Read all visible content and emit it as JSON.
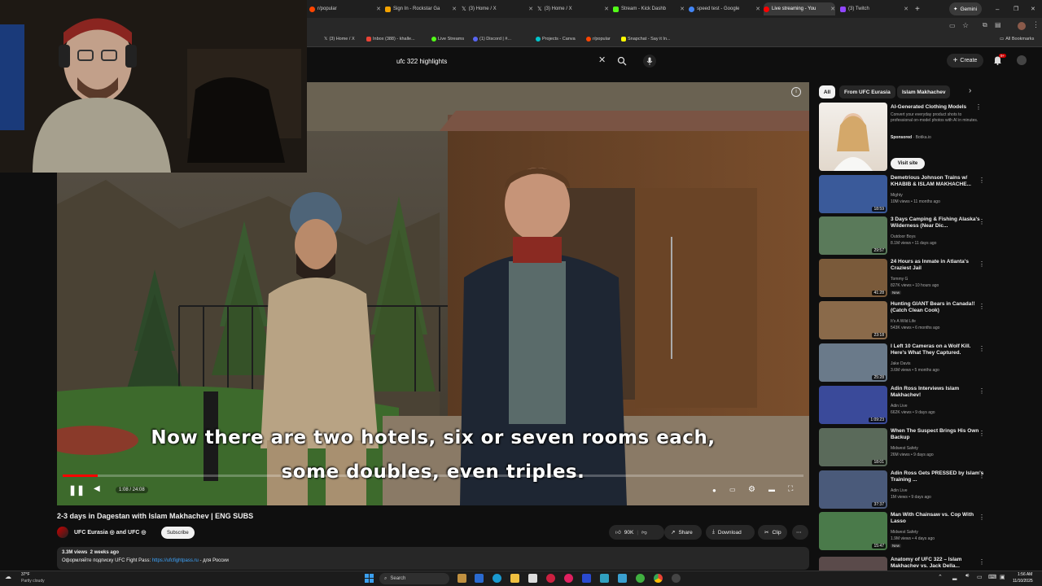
{
  "browser": {
    "tabs": [
      {
        "label": "r/popular",
        "color": "#ff4500"
      },
      {
        "label": "Sign In - Rockstar Ga",
        "color": "#f3a200"
      },
      {
        "label": "(3) Home / X",
        "color": "#ffffff"
      },
      {
        "label": "(3) Home / X",
        "color": "#ffffff"
      },
      {
        "label": "Stream - Kick Dashb",
        "color": "#53fc18"
      },
      {
        "label": "speed test - Google",
        "color": "#4285f4"
      },
      {
        "label": "Live streaming - You",
        "color": "#ff0000"
      },
      {
        "label": "(3) Twitch",
        "color": "#9146ff"
      }
    ],
    "gemini_label": "Gemini",
    "bookmarks": [
      {
        "label": "(3) Home / X",
        "color": "#ffffff"
      },
      {
        "label": "Inbox (388) - khalle...",
        "color": "#ea4335"
      },
      {
        "label": "Live Streams",
        "color": "#53fc18"
      },
      {
        "label": "(1) Discord | #...",
        "color": "#5865f2"
      },
      {
        "label": "Projects - Canva",
        "color": "#00c4cc"
      },
      {
        "label": "r/popular",
        "color": "#ff4500"
      },
      {
        "label": "Snapchat - Say it In...",
        "color": "#fffc00"
      }
    ],
    "all_bookmarks": "All Bookmarks"
  },
  "youtube": {
    "search_query": "ufc 322 highlights",
    "create_label": "Create",
    "notif_count": "9+"
  },
  "player": {
    "caption_line1": "Now there are two hotels, six or seven rooms each,",
    "caption_line2": "some doubles, even triples.",
    "time": "1:08 / 24:08",
    "progress": 0.047
  },
  "video": {
    "title": "2-3 days in Dagestan with Islam Makhachev | ENG SUBS",
    "channel": "UFC Eurasia ◎ and UFC ◎",
    "subscribe": "Subscribe",
    "likes": "90K",
    "share": "Share",
    "download": "Download",
    "clip": "Clip",
    "views_line": "3.3M views  2 weeks ago",
    "desc_prefix": "Оформляйте подписку UFC Fight Pass:",
    "desc_link": "https://ufcfightpass.ru",
    "desc_suffix": "- для России"
  },
  "sidebar": {
    "chips": [
      "All",
      "From UFC Eurasia",
      "Islam Makhachev"
    ],
    "ad": {
      "title": "AI-Generated Clothing Models",
      "desc": "Convert your everyday product shots to professional on-model photos with AI in minutes.",
      "sponsored": "Sponsored",
      "advertiser": "Botika.io",
      "cta": "Visit site"
    },
    "items": [
      {
        "title": "Demetrious Johnson Trains w/ KHABIB & ISLAM MAKHACHE...",
        "channel": "Mighty",
        "meta": "10M views • 11 months ago",
        "duration": "18:59",
        "new": "",
        "bg": "#3a5a9a"
      },
      {
        "title": "3 Days Camping & Fishing Alaska's Wilderness (Near Dic...",
        "channel": "Outdoor Boys",
        "meta": "8.1M views • 11 days ago",
        "duration": "29:57",
        "new": "",
        "bg": "#5a7a5a"
      },
      {
        "title": "24 Hours as Inmate in Atlanta's Craziest Jail",
        "channel": "Tommy G",
        "meta": "827K views • 10 hours ago",
        "duration": "41:28",
        "new": "New",
        "bg": "#7a5a3a"
      },
      {
        "title": "Hunting GIANT Bears in Canada!! (Catch Clean Cook)",
        "channel": "It's A Wild Life",
        "meta": "543K views • 6 months ago",
        "duration": "23:18",
        "new": "",
        "bg": "#8a6a4a"
      },
      {
        "title": "I Left 10 Cameras on a Wolf Kill. Here's What They Captured.",
        "channel": "Jake Davis",
        "meta": "3.6M views • 5 months ago",
        "duration": "25:28",
        "new": "",
        "bg": "#6a7a8a"
      },
      {
        "title": "Adin Ross Interviews Islam Makhachev!",
        "channel": "Adin Live",
        "meta": "662K views • 9 days ago",
        "duration": "1:09:23",
        "new": "",
        "bg": "#3a4a9a"
      },
      {
        "title": "When The Suspect Brings His Own Backup",
        "channel": "Midwest Safety",
        "meta": "26M views • 9 days ago",
        "duration": "18:01",
        "new": "",
        "bg": "#5a6a5a"
      },
      {
        "title": "Adin Ross Gets PRESSED by Islam's Training ...",
        "channel": "Adin Live",
        "meta": "1M views • 9 days ago",
        "duration": "37:37",
        "new": "",
        "bg": "#4a5a7a"
      },
      {
        "title": "Man With Chainsaw vs. Cop With Lasso",
        "channel": "Midwest Safety",
        "meta": "1.9M views • 4 days ago",
        "duration": "15:47",
        "new": "New",
        "bg": "#4a7a4a"
      },
      {
        "title": "Anatomy of UFC 322 – Islam Makhachev vs. Jack Della...",
        "channel": "",
        "meta": "",
        "duration": "",
        "new": "",
        "bg": "#5a4a4a"
      }
    ]
  },
  "taskbar": {
    "weather_temp": "37°F",
    "weather_desc": "Partly cloudy",
    "search": "Search",
    "time": "1:56 AM",
    "date": "11/10/2025"
  }
}
